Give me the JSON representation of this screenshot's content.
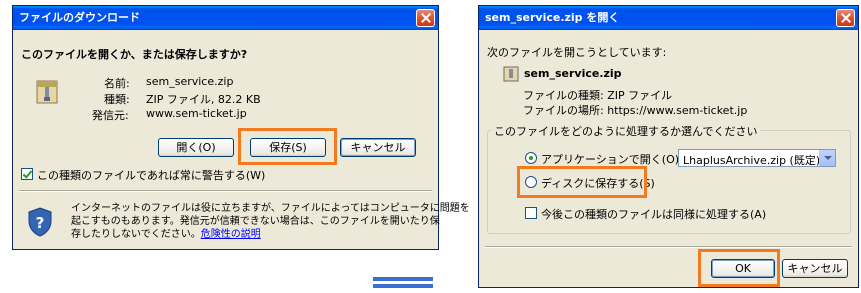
{
  "left_dialog": {
    "title": "ファイルのダウンロード",
    "question": "このファイルを開くか、または保存しますか?",
    "name_label": "名前:",
    "name_value": "sem_service.zip",
    "type_label": "種類:",
    "type_value": "ZIP ファイル, 82.2 KB",
    "from_label": "発信元:",
    "from_value": "www.sem-ticket.jp",
    "open_button": "開く(O)",
    "save_button": "保存(S)",
    "cancel_button": "キャンセル",
    "always_ask_label": "この種類のファイルであれば常に警告する(W)",
    "always_ask_checked": true,
    "warning_line1": "インターネットのファイルは役に立ちますが、ファイルによってはコンピュータに問題を",
    "warning_line2": "起こすものもあります。発信元が信頼できない場合は、このファイルを開いたり保",
    "warning_line3": "存したりしないでください。",
    "risk_link": "危険性の説明"
  },
  "right_dialog": {
    "title": "sem_service.zip を開く",
    "opening_label": "次のファイルを開こうとしています:",
    "filename": "sem_service.zip",
    "file_type_label": "ファイルの種類: ZIP ファイル",
    "file_location_label": "ファイルの場所: https://www.sem-ticket.jp",
    "group_label": "このファイルをどのように処理するか選んでください",
    "open_with_label": "アプリケーションで開く(O):",
    "open_with_app": "LhaplusArchive.zip (既定)",
    "save_to_disk_label": "ディスクに保存する(S)",
    "do_this_auto_label": "今後この種類のファイルは同様に処理する(A)",
    "ok_button": "OK",
    "cancel_button": "キャンセル"
  },
  "colors": {
    "highlight": "#f47a20",
    "arrow": "#3b6fd4",
    "dialog_bg": "#ece9d8"
  }
}
